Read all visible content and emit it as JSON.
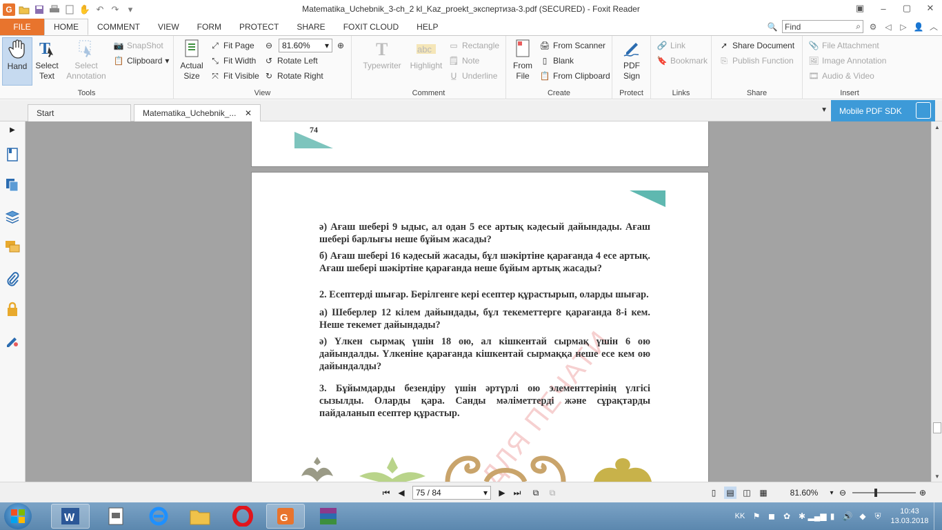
{
  "window": {
    "title": "Matematika_Uchebnik_3-ch_2 kl_Kaz_proekt_экспертиза-3.pdf (SECURED) - Foxit Reader"
  },
  "menu_tabs": [
    {
      "label": "FILE"
    },
    {
      "label": "HOME"
    },
    {
      "label": "COMMENT"
    },
    {
      "label": "VIEW"
    },
    {
      "label": "FORM"
    },
    {
      "label": "PROTECT"
    },
    {
      "label": "SHARE"
    },
    {
      "label": "FOXIT CLOUD"
    },
    {
      "label": "HELP"
    }
  ],
  "find": {
    "placeholder": "Find"
  },
  "ribbon": {
    "tools": {
      "label": "Tools",
      "hand": "Hand",
      "select_text_1": "Select",
      "select_text_2": "Text",
      "select_annot_1": "Select",
      "select_annot_2": "Annotation",
      "snapshot": "SnapShot",
      "clipboard": "Clipboard"
    },
    "view": {
      "label": "View",
      "actual_size_1": "Actual",
      "actual_size_2": "Size",
      "fit_page": "Fit Page",
      "fit_width": "Fit Width",
      "fit_visible": "Fit Visible",
      "zoom_value": "81.60%",
      "rotate_left": "Rotate Left",
      "rotate_right": "Rotate Right"
    },
    "comment": {
      "label": "Comment",
      "typewriter": "Typewriter",
      "highlight": "Highlight",
      "rectangle": "Rectangle",
      "note": "Note",
      "underline": "Underline"
    },
    "create": {
      "label": "Create",
      "from_file_1": "From",
      "from_file_2": "File",
      "from_scanner": "From Scanner",
      "blank": "Blank",
      "from_clipboard": "From Clipboard"
    },
    "protect": {
      "label": "Protect",
      "pdf_sign_1": "PDF",
      "pdf_sign_2": "Sign"
    },
    "links": {
      "label": "Links",
      "link": "Link",
      "bookmark": "Bookmark"
    },
    "share": {
      "label": "Share",
      "share_document": "Share Document",
      "publish_function": "Publish Function"
    },
    "insert": {
      "label": "Insert",
      "file_attachment": "File Attachment",
      "image_annotation": "Image Annotation",
      "audio_video": "Audio & Video"
    }
  },
  "doc_tabs": [
    {
      "label": "Start"
    },
    {
      "label": "Matematika_Uchebnik_..."
    }
  ],
  "mobile_sdk": "Mobile PDF SDK",
  "document": {
    "prev_page_number": "74",
    "paragraphs": [
      "ә) Ағаш шебері  9 ыдыс, ал одан 5 есе артық кәдесый дайындады. Ағаш шебері барлығы неше бұйым жасады?",
      "б) Ағаш шебері 16 кәдесый жасады, бұл шәкіртіне қарағанда 4 есе артық. Ағаш шебері шәкіртіне қарағанда неше бұйым артық жасады?",
      "2. Есептерді шығар. Берілгенге кері есептер құрастырып, оларды шығар.",
      "а) Шеберлер 12 кілем дайындады, бұл текеметтерге қарағанда 8-і кем. Неше текемет дайындады?",
      "ә) Үлкен сырмақ үшін 18  ою, ал кішкентай сырмақ үшін 6 ою дайындалды. Үлкеніне қарағанда кішкентай сырмаққа неше есе кем ою дайындалды?",
      "3. Бұйымдарды безендіру үшін әртүрлі ою элементтерінің үлгісі сызылды. Оларды қара. Санды мәліметтерді және сұрақтарды пайдаланып есептер құрастыр."
    ],
    "watermark": "НЕ ДЛЯ ПЕЧАТИ"
  },
  "statusbar": {
    "page_indicator": "75 / 84",
    "zoom": "81.60%"
  },
  "taskbar": {
    "language": "KK",
    "time": "10:43",
    "date": "13.03.2018"
  },
  "colors": {
    "accent": "#e8742d",
    "sdk_blue": "#3d9ad8",
    "page_teal": "#5fb8b0"
  }
}
